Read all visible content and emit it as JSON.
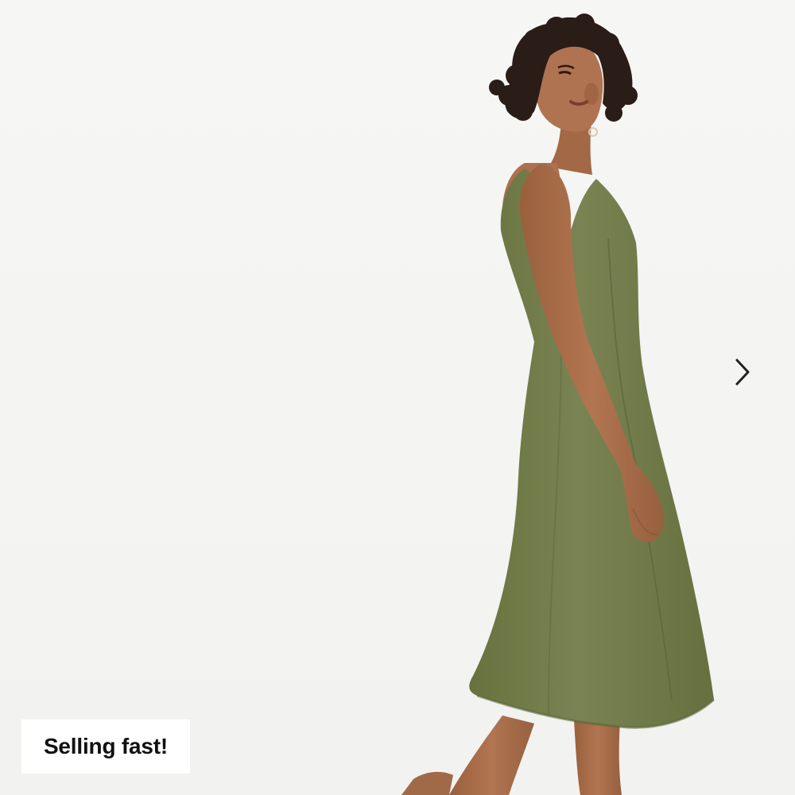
{
  "product_image": {
    "subject": "model-in-sleeveless-midi-dress",
    "dress_color": "#727c4e",
    "skin_color": "#a86d4a",
    "hair_color": "#2a1c16",
    "background_color": "#f4f4f2"
  },
  "carousel": {
    "next_icon": "chevron-right-icon",
    "icon_color": "#222222"
  },
  "badge": {
    "label": "Selling fast!"
  }
}
